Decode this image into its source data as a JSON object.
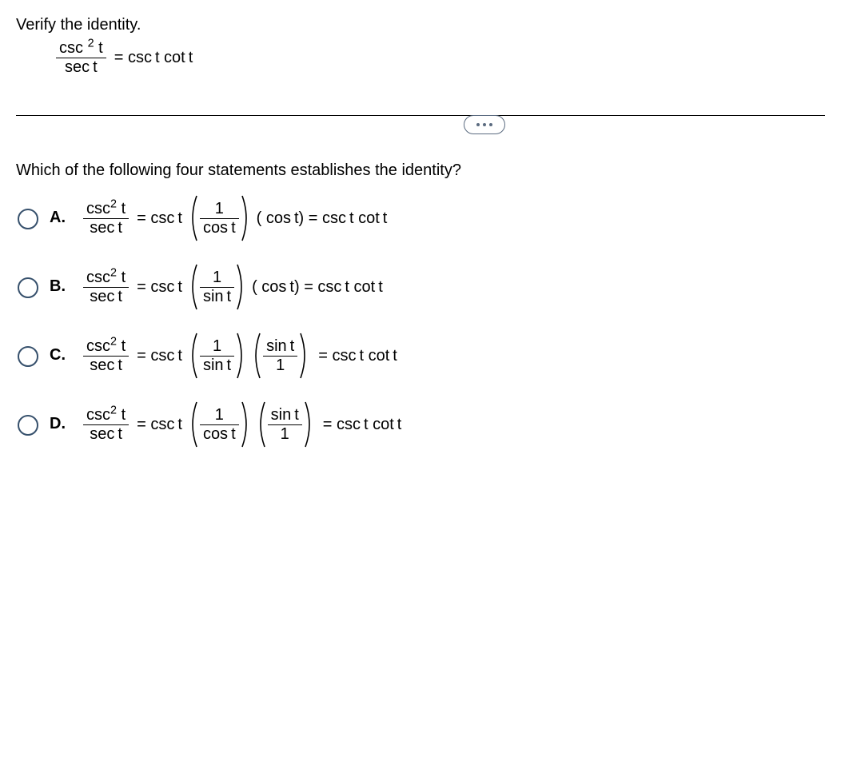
{
  "prompt": "Verify the identity.",
  "identity": {
    "lhs_num_a": "csc",
    "lhs_num_exp": "2",
    "lhs_num_b": "t",
    "lhs_den": "sec t",
    "rhs": "= csc t cot t"
  },
  "question": "Which of the following four statements establishes the identity?",
  "choices": [
    {
      "label": "A.",
      "lhs_num_a": "csc",
      "lhs_num_exp": "2",
      "lhs_num_b": "t",
      "lhs_den": "sec t",
      "mid_pre": "= csc t",
      "p1_num": "1",
      "p1_den": "cos t",
      "after_p1": "( cos t) = csc t cot t",
      "has_p2": false
    },
    {
      "label": "B.",
      "lhs_num_a": "csc",
      "lhs_num_exp": "2",
      "lhs_num_b": "t",
      "lhs_den": "sec t",
      "mid_pre": "= csc t",
      "p1_num": "1",
      "p1_den": "sin t",
      "after_p1": "( cos t) = csc t cot t",
      "has_p2": false
    },
    {
      "label": "C.",
      "lhs_num_a": "csc",
      "lhs_num_exp": "2",
      "lhs_num_b": "t",
      "lhs_den": "sec t",
      "mid_pre": "= csc t",
      "p1_num": "1",
      "p1_den": "sin t",
      "has_p2": true,
      "p2_num": "sin t",
      "p2_den": "1",
      "after_p2": "= csc t cot t"
    },
    {
      "label": "D.",
      "lhs_num_a": "csc",
      "lhs_num_exp": "2",
      "lhs_num_b": "t",
      "lhs_den": "sec t",
      "mid_pre": "= csc t",
      "p1_num": "1",
      "p1_den": "cos t",
      "has_p2": true,
      "p2_num": "sin t",
      "p2_den": "1",
      "after_p2": "= csc t cot t"
    }
  ]
}
